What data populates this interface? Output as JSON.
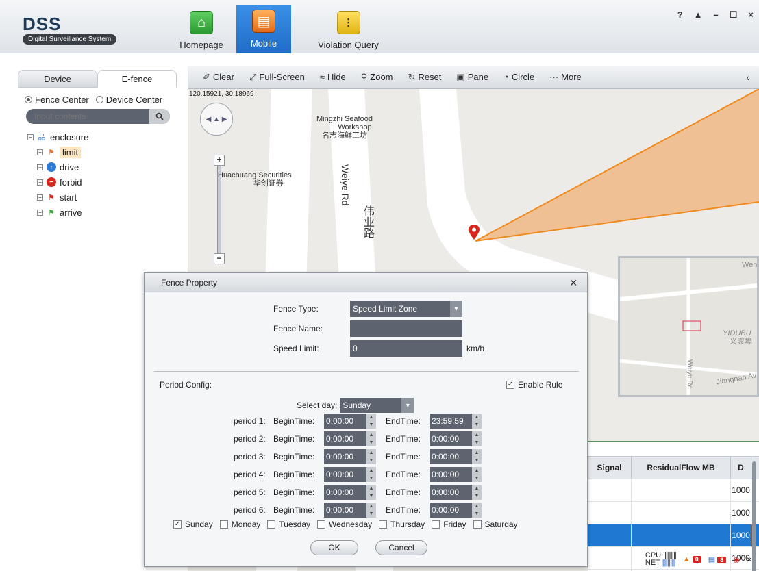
{
  "app": {
    "title": "DSS",
    "subtitle": "Digital Surveillance System",
    "modules": [
      {
        "label": "Homepage"
      },
      {
        "label": "Mobile"
      },
      {
        "label": "Violation Query"
      }
    ],
    "window_controls": {
      "help": "?",
      "lock": "🔒",
      "minimize": "–",
      "maximize": "☐",
      "close": "×"
    }
  },
  "left_panel": {
    "tabs": [
      {
        "label": "Device"
      },
      {
        "label": "E-fence"
      }
    ],
    "active_tab": "E-fence",
    "radio_options": [
      {
        "label": "Fence Center"
      },
      {
        "label": "Device Center"
      }
    ],
    "search_placeholder": "Input contents",
    "tree": {
      "root": "enclosure",
      "children": [
        {
          "label": "limit",
          "selected": true
        },
        {
          "label": "drive"
        },
        {
          "label": "forbid"
        },
        {
          "label": "start"
        },
        {
          "label": "arrive"
        }
      ]
    }
  },
  "map": {
    "toolbar": [
      {
        "label": "Clear"
      },
      {
        "label": "Full-Screen"
      },
      {
        "label": "Hide"
      },
      {
        "label": "Zoom"
      },
      {
        "label": "Reset"
      },
      {
        "label": "Pane"
      },
      {
        "label": "Circle"
      },
      {
        "label": "More"
      }
    ],
    "coordinates": "120.15921, 30.18969",
    "labels": {
      "poi1_en": "Mingzhi Seafood",
      "poi1_en2": "Workshop",
      "poi1_cn": "名志海鲜工坊",
      "poi2_en": "Huachuang Securities",
      "poi2_cn": "华创证券",
      "road_en": "Weiye Rd",
      "road_cn": "伟业路"
    },
    "overview_labels": {
      "yidubu": "YIDUBU",
      "yidubu_cn": "义渡埠",
      "weiye": "Weiye Rc",
      "jiangnan": "Jiangnan Ave",
      "wen": "Wen"
    }
  },
  "grid": {
    "columns": [
      "Signal",
      "ResidualFlow MB",
      "D"
    ],
    "rows": [
      {
        "signal": "",
        "flow": "",
        "d": "1000"
      },
      {
        "signal": "",
        "flow": "",
        "d": "1000"
      },
      {
        "signal": "",
        "flow": "",
        "d": "1000"
      },
      {
        "signal": "",
        "flow": "",
        "d": "1000"
      },
      {
        "signal": "",
        "flow": "",
        "d": "1000"
      }
    ],
    "selected_row": 2
  },
  "status": {
    "cpu": "CPU",
    "net": "NET",
    "alarm_count": "0",
    "msg_count": "8"
  },
  "dialog": {
    "title": "Fence Property",
    "fence_type_label": "Fence Type:",
    "fence_type_value": "Speed Limit Zone",
    "fence_name_label": "Fence Name:",
    "fence_name_value": "",
    "speed_limit_label": "Speed Limit:",
    "speed_limit_value": "0",
    "speed_unit": "km/h",
    "period_config_label": "Period Config:",
    "enable_rule_label": "Enable Rule",
    "enable_rule_checked": true,
    "select_day_label": "Select day:",
    "select_day_value": "Sunday",
    "periods": [
      {
        "label": "period 1:",
        "begin_label": "BeginTime:",
        "begin": "0:00:00",
        "end_label": "EndTime:",
        "end": "23:59:59"
      },
      {
        "label": "period 2:",
        "begin_label": "BeginTime:",
        "begin": "0:00:00",
        "end_label": "EndTime:",
        "end": "0:00:00"
      },
      {
        "label": "period 3:",
        "begin_label": "BeginTime:",
        "begin": "0:00:00",
        "end_label": "EndTime:",
        "end": "0:00:00"
      },
      {
        "label": "period 4:",
        "begin_label": "BeginTime:",
        "begin": "0:00:00",
        "end_label": "EndTime:",
        "end": "0:00:00"
      },
      {
        "label": "period 5:",
        "begin_label": "BeginTime:",
        "begin": "0:00:00",
        "end_label": "EndTime:",
        "end": "0:00:00"
      },
      {
        "label": "period 6:",
        "begin_label": "BeginTime:",
        "begin": "0:00:00",
        "end_label": "EndTime:",
        "end": "0:00:00"
      }
    ],
    "days": [
      {
        "label": "Sunday",
        "checked": true
      },
      {
        "label": "Monday",
        "checked": false
      },
      {
        "label": "Tuesday",
        "checked": false
      },
      {
        "label": "Wednesday",
        "checked": false
      },
      {
        "label": "Thursday",
        "checked": false
      },
      {
        "label": "Friday",
        "checked": false
      },
      {
        "label": "Saturday",
        "checked": false
      }
    ],
    "ok_label": "OK",
    "cancel_label": "Cancel"
  },
  "colors": {
    "accent": "#1f6cc7",
    "fence_fill": "#f2b27a",
    "fence_stroke": "#f08a1e",
    "marker": "#d9261c",
    "field_bg": "#5d6470"
  }
}
